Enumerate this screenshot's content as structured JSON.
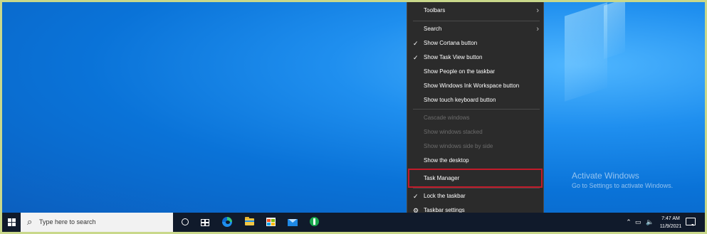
{
  "context_menu": {
    "items": [
      {
        "label": "Toolbars",
        "checked": false,
        "disabled": false,
        "submenu": true
      },
      {
        "label": "Search",
        "checked": false,
        "disabled": false,
        "submenu": true
      },
      {
        "label": "Show Cortana button",
        "checked": true,
        "disabled": false
      },
      {
        "label": "Show Task View button",
        "checked": true,
        "disabled": false
      },
      {
        "label": "Show People on the taskbar",
        "checked": false,
        "disabled": false
      },
      {
        "label": "Show Windows Ink Workspace button",
        "checked": false,
        "disabled": false
      },
      {
        "label": "Show touch keyboard button",
        "checked": false,
        "disabled": false
      },
      {
        "label": "Cascade windows",
        "checked": false,
        "disabled": true
      },
      {
        "label": "Show windows stacked",
        "checked": false,
        "disabled": true
      },
      {
        "label": "Show windows side by side",
        "checked": false,
        "disabled": true
      },
      {
        "label": "Show the desktop",
        "checked": false,
        "disabled": false
      },
      {
        "label": "Task Manager",
        "checked": false,
        "disabled": false,
        "highlighted": true
      },
      {
        "label": "Lock the taskbar",
        "checked": true,
        "disabled": false
      },
      {
        "label": "Taskbar settings",
        "checked": false,
        "disabled": false,
        "icon": "gear-icon"
      }
    ],
    "check_glyph": "✓",
    "arrow_glyph": "›",
    "highlight_color": "#c21b2a"
  },
  "watermark": {
    "line1": "Activate Windows",
    "line2": "Go to Settings to activate Windows."
  },
  "taskbar": {
    "search_placeholder": "Type here to search",
    "pinned_icons": [
      "cortana-icon",
      "task-view-icon",
      "edge-icon",
      "file-explorer-icon",
      "store-icon",
      "mail-icon",
      "app-icon"
    ],
    "clock_time": "7:47 AM",
    "clock_date": "11/9/2021",
    "tray_icons": [
      "chevron-up-icon",
      "network-icon",
      "volume-icon"
    ],
    "background": "#101a2b"
  },
  "desktop": {
    "accent": "#0a78d4"
  }
}
